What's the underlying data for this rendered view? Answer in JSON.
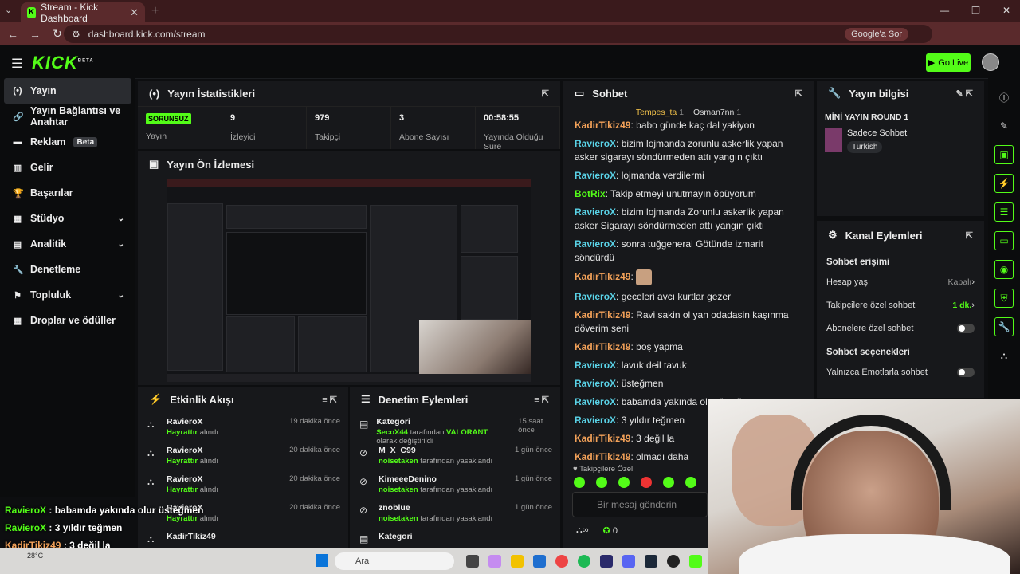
{
  "browser": {
    "tab_title": "Stream - Kick Dashboard",
    "url": "dashboard.kick.com/stream",
    "google_btn": "Google'a Sor"
  },
  "header": {
    "logo": "KICK",
    "logo_sup": "BETA",
    "go_live": "Go Live"
  },
  "sidebar": {
    "items": [
      {
        "label": "Yayın",
        "icon": "broadcast-icon",
        "active": true
      },
      {
        "label": "Yayın Bağlantısı ve Anahtar",
        "icon": "link-icon"
      },
      {
        "label": "Reklam",
        "icon": "ad-icon",
        "badge": "Beta"
      },
      {
        "label": "Gelir",
        "icon": "revenue-icon"
      },
      {
        "label": "Başarılar",
        "icon": "trophy-icon"
      },
      {
        "label": "Stüdyo",
        "icon": "studio-icon",
        "chevron": true
      },
      {
        "label": "Analitik",
        "icon": "analytics-icon",
        "chevron": true
      },
      {
        "label": "Denetleme",
        "icon": "wrench-icon"
      },
      {
        "label": "Topluluk",
        "icon": "community-icon",
        "chevron": true
      },
      {
        "label": "Droplar ve ödüller",
        "icon": "drops-icon"
      }
    ]
  },
  "stats": {
    "title": "Yayın İstatistikleri",
    "status_badge": "SORUNSUZ",
    "items": [
      {
        "value": "",
        "label": "Yayın"
      },
      {
        "value": "9",
        "label": "İzleyici"
      },
      {
        "value": "979",
        "label": "Takipçi"
      },
      {
        "value": "3",
        "label": "Abone Sayısı"
      },
      {
        "value": "00:58:55",
        "label": "Yayında Olduğu Süre"
      }
    ]
  },
  "preview": {
    "title": "Yayın Ön İzlemesi"
  },
  "activity": {
    "title": "Etkinlik Akışı",
    "items": [
      {
        "user": "RavieroX",
        "action": "Hayrattır",
        "suffix": "alındı",
        "time": "19 dakika önce"
      },
      {
        "user": "RavieroX",
        "action": "Hayrattır",
        "suffix": "alındı",
        "time": "20 dakika önce"
      },
      {
        "user": "RavieroX",
        "action": "Hayrattır",
        "suffix": "alındı",
        "time": "20 dakika önce"
      },
      {
        "user": "RavieroX",
        "action": "Hayrattır",
        "suffix": "alındı",
        "time": "20 dakika önce"
      },
      {
        "user": "KadirTikiz49",
        "action": "",
        "suffix": "",
        "time": ""
      }
    ]
  },
  "moderation": {
    "title": "Denetim Eylemleri",
    "items": [
      {
        "title": "Kategori",
        "who": "SecoX44",
        "text": "tarafından",
        "extra": "VALORANT",
        "tail": "olarak değiştirildi",
        "time": "15 saat önce"
      },
      {
        "title": "M_X_C99",
        "who": "noisetaken",
        "text": "tarafından yasaklandı",
        "extra": "",
        "tail": "",
        "time": "1 gün önce"
      },
      {
        "title": "KimeeeDenino",
        "who": "noisetaken",
        "text": "tarafından yasaklandı",
        "extra": "",
        "tail": "",
        "time": "1 gün önce"
      },
      {
        "title": "znoblue",
        "who": "noisetaken",
        "text": "tarafından yasaklandı",
        "extra": "",
        "tail": "",
        "time": "1 gün önce"
      },
      {
        "title": "Kategori",
        "who": "",
        "text": "",
        "extra": "",
        "tail": "",
        "time": ""
      }
    ]
  },
  "chat": {
    "title": "Sohbet",
    "pinned": [
      {
        "name": "Tempes_ta",
        "n": "1"
      },
      {
        "name": "Osman7nn",
        "n": "1"
      }
    ],
    "messages": [
      {
        "user": "KadirTikiz49",
        "c": "u1",
        "text": ": babo günde kaç dal yakiyon"
      },
      {
        "user": "RavieroX",
        "c": "u2",
        "text": ": bizim lojmanda zorunlu askerlik yapan asker sigarayı söndürmeden attı yangın çıktı"
      },
      {
        "user": "RavieroX",
        "c": "u2",
        "text": ": lojmanda verdilermi"
      },
      {
        "user": "BotRix",
        "c": "u3",
        "text": ": Takip etmeyi unutmayın öpüyorum"
      },
      {
        "user": "RavieroX",
        "c": "u2",
        "text": ": bizim lojmanda Zorunlu askerlik yapan asker Sigarayı söndürmeden attı yangın çıktı"
      },
      {
        "user": "RavieroX",
        "c": "u2",
        "text": ": sonra tuğgeneral Götünde izmarit söndürdü"
      },
      {
        "user": "KadirTikiz49",
        "c": "u1",
        "text": ":",
        "emote": true
      },
      {
        "user": "RavieroX",
        "c": "u2",
        "text": ": geceleri avcı kurtlar gezer"
      },
      {
        "user": "KadirTikiz49",
        "c": "u1",
        "text": ": Ravi sakin ol yan odadasin kaşınma döverim seni"
      },
      {
        "user": "KadirTikiz49",
        "c": "u1",
        "text": ": boş yapma"
      },
      {
        "user": "RavieroX",
        "c": "u2",
        "text": ": lavuk deil tavuk"
      },
      {
        "user": "RavieroX",
        "c": "u2",
        "text": ": üsteğmen"
      },
      {
        "user": "RavieroX",
        "c": "u2",
        "text": ": babamda yakında olur üsteğmen"
      },
      {
        "user": "RavieroX",
        "c": "u2",
        "text": ": 3 yıldır teğmen"
      },
      {
        "user": "KadirTikiz49",
        "c": "u1",
        "text": ": 3 değil la"
      },
      {
        "user": "KadirTikiz49",
        "c": "u1",
        "text": ": olmadı daha"
      }
    ],
    "followers_only": "Takipçilere Özel",
    "input_placeholder": "Bir mesaj gönderin",
    "count": "0"
  },
  "info": {
    "title": "Yayın bilgisi",
    "stream_title": "MİNİ YAYIN ROUND 1",
    "category": "Sadece Sohbet",
    "tag": "Turkish"
  },
  "channel": {
    "title": "Kanal Eylemleri",
    "access_title": "Sohbet erişimi",
    "rows": [
      {
        "label": "Hesap yaşı",
        "value": "Kapalı"
      },
      {
        "label": "Takipçilere özel sohbet",
        "value": "1 dk."
      },
      {
        "label": "Abonelere özel sohbet",
        "value": ""
      }
    ],
    "options_title": "Sohbet seçenekleri",
    "emote_only": "Yalnızca Emotlarla sohbet"
  },
  "overlay": [
    {
      "user": "RavieroX",
      "c": "u3",
      "text": " : babamda yakında olur üsteğmen"
    },
    {
      "user": "RavieroX",
      "c": "u3",
      "text": " : 3 yıldır teğmen"
    },
    {
      "user": "KadirTikiz49",
      "c": "u1",
      "text": " : 3 değil la"
    },
    {
      "user": "KadirTikiz49",
      "c": "u1",
      "text": " : olmadı daha"
    }
  ],
  "taskbar": {
    "search": "Ara",
    "temp": "28°C"
  }
}
